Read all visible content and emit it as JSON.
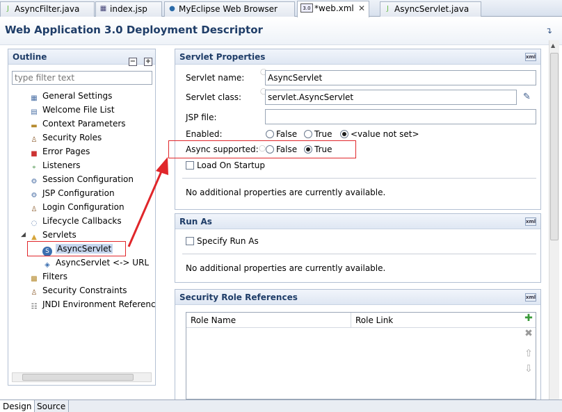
{
  "tabs": [
    {
      "label": "AsyncFilter.java",
      "icon": "java-file-icon"
    },
    {
      "label": "index.jsp",
      "icon": "jsp-file-icon"
    },
    {
      "label": "MyEclipse Web Browser",
      "icon": "globe-icon"
    },
    {
      "label": "*web.xml",
      "icon": "xml-file-icon",
      "badge": "3.0"
    },
    {
      "label": "AsyncServlet.java",
      "icon": "java-file-icon"
    }
  ],
  "header": {
    "title": "Web Application 3.0 Deployment Descriptor"
  },
  "outline": {
    "title": "Outline",
    "filter_placeholder": "type filter text",
    "items": [
      {
        "label": "General Settings",
        "icon": "settings-icon"
      },
      {
        "label": "Welcome File List",
        "icon": "welcome-file-icon"
      },
      {
        "label": "Context Parameters",
        "icon": "parameters-icon"
      },
      {
        "label": "Security Roles",
        "icon": "security-roles-icon"
      },
      {
        "label": "Error Pages",
        "icon": "error-page-icon"
      },
      {
        "label": "Listeners",
        "icon": "listener-icon"
      },
      {
        "label": "Session Configuration",
        "icon": "session-icon"
      },
      {
        "label": "JSP Configuration",
        "icon": "jsp-config-icon"
      },
      {
        "label": "Login Configuration",
        "icon": "login-icon"
      },
      {
        "label": "Lifecycle Callbacks",
        "icon": "lifecycle-icon"
      },
      {
        "label": "Servlets",
        "icon": "folder-icon"
      },
      {
        "label": "AsyncServlet",
        "icon": "servlet-icon"
      },
      {
        "label": "AsyncServlet <-> URL",
        "icon": "mapping-icon"
      },
      {
        "label": "Filters",
        "icon": "filter-icon"
      },
      {
        "label": "Security Constraints",
        "icon": "constraint-icon"
      },
      {
        "label": "JNDI Environment Referenc",
        "icon": "jndi-icon"
      }
    ]
  },
  "servlet_properties": {
    "title": "Servlet Properties",
    "name_label": "Servlet name:",
    "name_value": "AsyncServlet",
    "class_label": "Servlet class:",
    "class_value": "servlet.AsyncServlet",
    "jsp_label": "JSP file:",
    "jsp_value": "",
    "enabled_label": "Enabled:",
    "enabled_options": [
      "False",
      "True",
      "<value not set>"
    ],
    "enabled_selected": "<value not set>",
    "async_label": "Async supported:",
    "async_options": [
      "False",
      "True"
    ],
    "async_selected": "True",
    "load_on_startup_label": "Load On Startup",
    "no_props": "No additional properties are currently available."
  },
  "run_as": {
    "title": "Run As",
    "specify_label": "Specify Run As",
    "no_props": "No additional properties are currently available."
  },
  "security_role_refs": {
    "title": "Security Role References",
    "columns": [
      "Role Name",
      "Role Link"
    ]
  },
  "bottom_tabs": [
    "Design",
    "Source"
  ],
  "colors": {
    "accent": "#1f3d68",
    "highlight": "#e0262a"
  }
}
